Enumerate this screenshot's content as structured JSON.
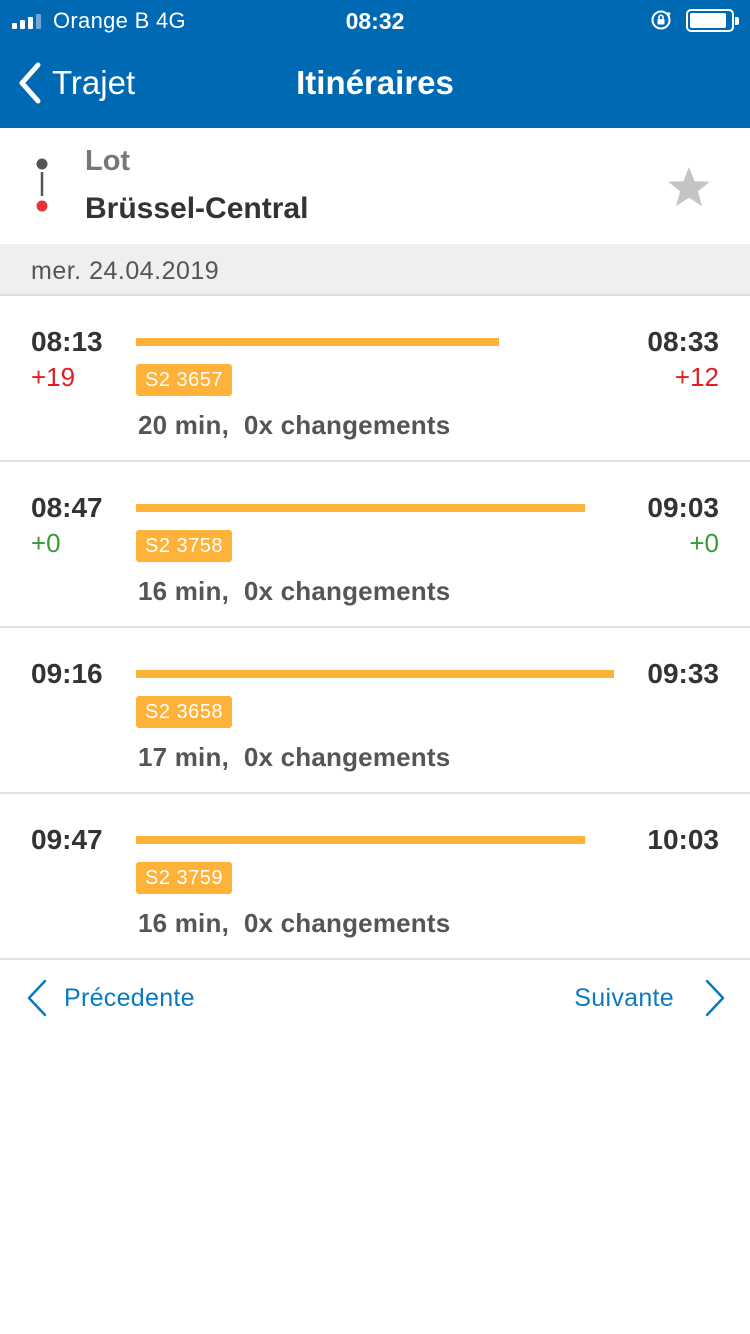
{
  "status_bar": {
    "carrier": "Orange B  4G",
    "time": "08:32",
    "signal_icon": "signal-bars-icon",
    "lock_icon": "rotation-lock-icon",
    "battery_icon": "battery-icon"
  },
  "nav": {
    "back_label": "Trajet",
    "title": "Itinéraires"
  },
  "route": {
    "from": "Lot",
    "to": "Brüssel-Central",
    "favorite_icon": "star-icon"
  },
  "date": "mer. 24.04.2019",
  "colors": {
    "header_bg": "#0069b4",
    "accent_orange": "#ffb23a",
    "delay_red": "#e02020",
    "ontime_green": "#3a9a3a",
    "link_blue": "#0a7ac0"
  },
  "connections": [
    {
      "departure": "08:13",
      "arrival": "08:33",
      "departure_delay": "+19",
      "arrival_delay": "+12",
      "delay_status": "late",
      "train": "S2 3657",
      "duration": "20 min,",
      "changes": "0x changements",
      "bar_fraction": 0.76
    },
    {
      "departure": "08:47",
      "arrival": "09:03",
      "departure_delay": "+0",
      "arrival_delay": "+0",
      "delay_status": "ontime",
      "train": "S2 3758",
      "duration": "16 min,",
      "changes": "0x changements",
      "bar_fraction": 0.94
    },
    {
      "departure": "09:16",
      "arrival": "09:33",
      "departure_delay": "",
      "arrival_delay": "",
      "delay_status": "none",
      "train": "S2 3658",
      "duration": "17 min,",
      "changes": "0x changements",
      "bar_fraction": 1.0
    },
    {
      "departure": "09:47",
      "arrival": "10:03",
      "departure_delay": "",
      "arrival_delay": "",
      "delay_status": "none",
      "train": "S2 3759",
      "duration": "16 min,",
      "changes": "0x changements",
      "bar_fraction": 0.94
    }
  ],
  "pagination": {
    "previous": "Précedente",
    "next": "Suivante"
  }
}
